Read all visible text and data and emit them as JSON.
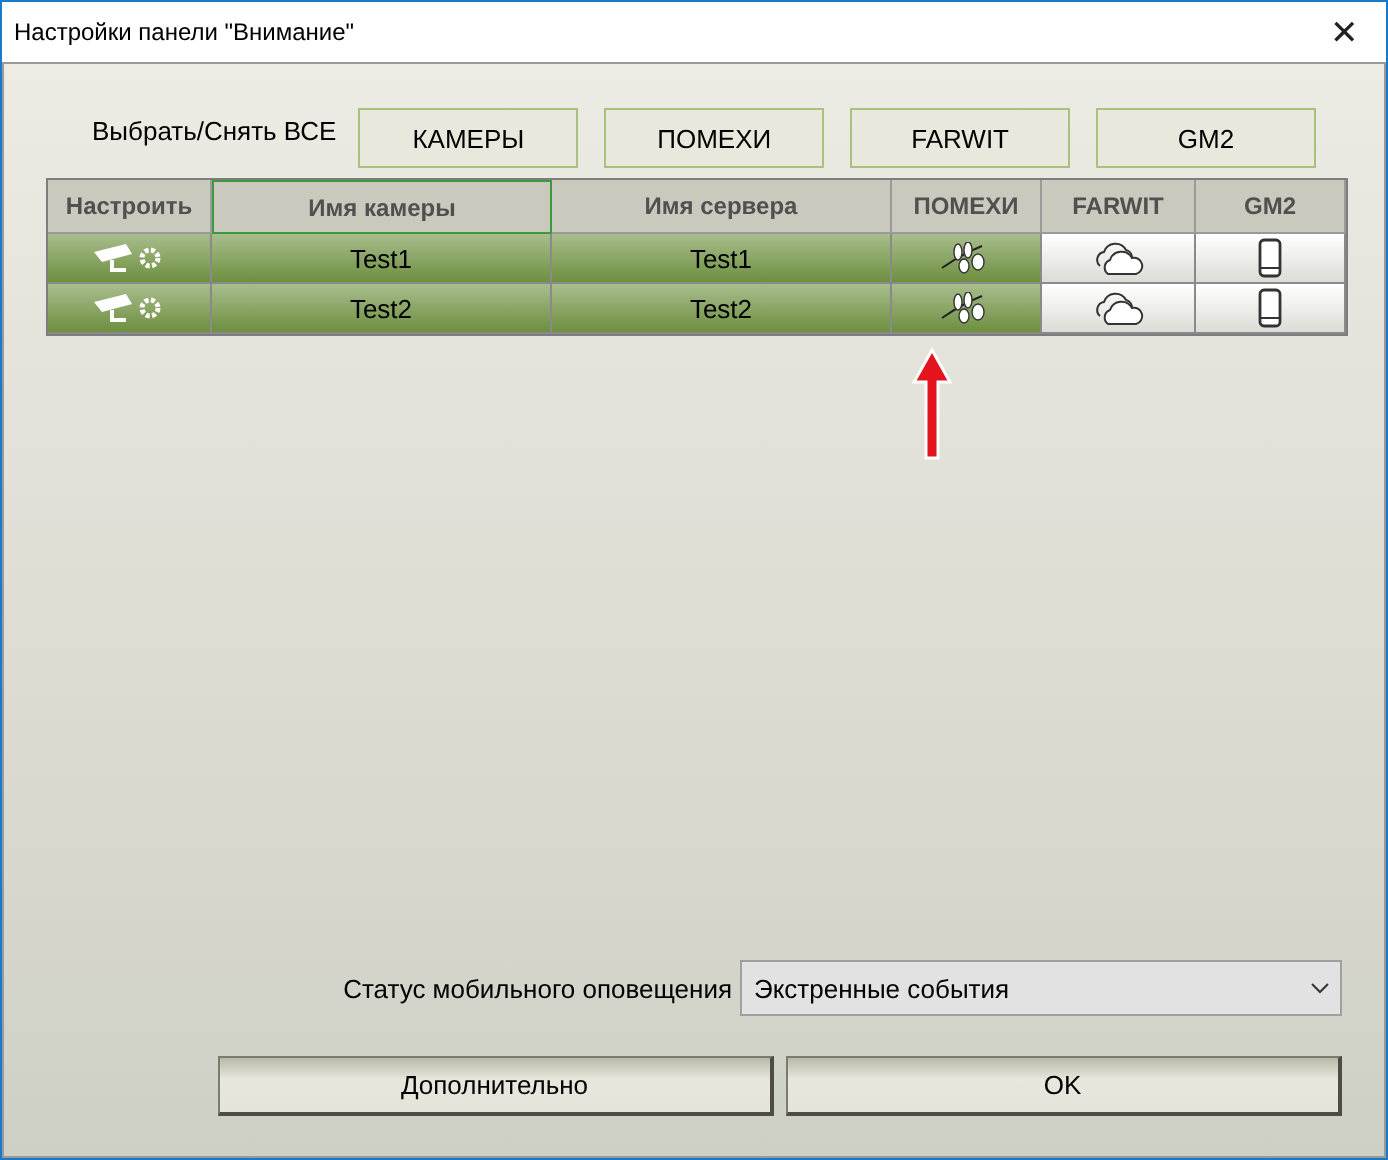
{
  "window": {
    "title": "Настройки панели \"Внимание\"",
    "close": "✕"
  },
  "select_all": {
    "label": "Выбрать/Снять ВСЕ",
    "buttons": [
      "КАМЕРЫ",
      "ПОМЕХИ",
      "FARWIT",
      "GM2"
    ]
  },
  "table": {
    "columns": [
      {
        "label": "Настроить",
        "selected": false
      },
      {
        "label": "Имя камеры",
        "selected": true
      },
      {
        "label": "Имя сервера",
        "selected": false
      },
      {
        "label": "ПОМЕХИ",
        "selected": false
      },
      {
        "label": "FARWIT",
        "selected": false
      },
      {
        "label": "GM2",
        "selected": false
      }
    ],
    "rows": [
      {
        "camera": "Test1",
        "server": "Test1",
        "pomehi": true,
        "farwit": false,
        "gm2": false
      },
      {
        "camera": "Test2",
        "server": "Test2",
        "pomehi": true,
        "farwit": false,
        "gm2": false
      }
    ]
  },
  "mobile_status": {
    "label": "Статус мобильного оповещения",
    "value": "Экстренные события"
  },
  "buttons": [
    "Дополнительно",
    "OK"
  ]
}
